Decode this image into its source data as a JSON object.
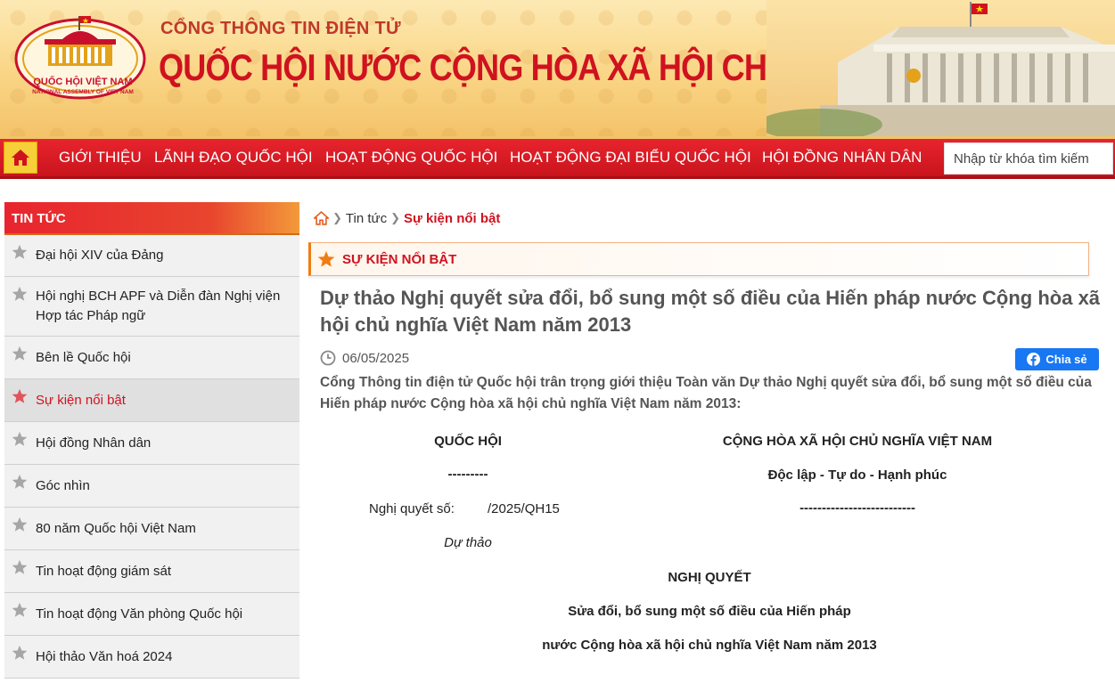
{
  "header": {
    "emblem_line1": "QUỐC HỘI VIỆT NAM",
    "emblem_line2": "NATIONAL ASSEMBLY OF VIET NAM",
    "portal_subtitle": "CỔNG THÔNG TIN ĐIỆN TỬ",
    "portal_title": "QUỐC HỘI NƯỚC CỘNG HÒA XÃ HỘI CHỦ NGHĨA VIỆT NAM"
  },
  "nav": {
    "items": [
      "GIỚI THIỆU",
      "LÃNH ĐẠO QUỐC HỘI",
      "HOẠT ĐỘNG QUỐC HỘI",
      "HOẠT ĐỘNG ĐẠI BIỂU QUỐC HỘI",
      "HỘI ĐỒNG NHÂN DÂN"
    ],
    "search_placeholder": "Nhập từ khóa tìm kiếm"
  },
  "sidebar": {
    "title": "TIN TỨC",
    "items": [
      "Đại hội XIV của Đảng",
      "Hội nghị BCH APF và Diễn đàn Nghị viện Hợp tác Pháp ngữ",
      "Bên lề Quốc hội",
      "Sự kiện nổi bật",
      "Hội đồng Nhân dân",
      "Góc nhìn",
      "80 năm Quốc hội Việt Nam",
      "Tin hoạt động giám sát",
      "Tin hoạt động Văn phòng Quốc hội",
      "Hội thảo Văn hoá 2024"
    ],
    "active_index": 3
  },
  "breadcrumb": {
    "news": "Tin tức",
    "current": "Sự kiện nổi bật"
  },
  "section": {
    "title": "SỰ KIỆN NỔI BẬT"
  },
  "article": {
    "title": "Dự thảo Nghị quyết sửa đổi, bổ sung một số điều của Hiến pháp nước Cộng hòa xã hội chủ nghĩa Việt Nam năm 2013",
    "date": "06/05/2025",
    "share_label": "Chia sẻ",
    "intro": "Cổng Thông tin điện tử Quốc hội trân trọng giới thiệu Toàn văn Dự thảo Nghị quyết sửa đổi, bổ sung một số điều của Hiến pháp nước Cộng hòa xã hội chủ nghĩa Việt Nam năm 2013:",
    "doc": {
      "org": "QUỐC HỘI",
      "org_rule": "---------",
      "resolution_no_label": "Nghị quyết số:",
      "resolution_no": "/2025/QH15",
      "draft": "Dự thảo",
      "country": "CỘNG HÒA XÃ HỘI CHỦ NGHĨA VIỆT NAM",
      "motto": "Độc lập - Tự do - Hạnh phúc",
      "motto_rule": "--------------------------",
      "heading": "NGHỊ QUYẾT",
      "subheading1": "Sửa đổi, bổ sung một số điều của Hiến pháp",
      "subheading2": "nước Cộng hòa xã hội chủ nghĩa Việt Nam năm 2013"
    }
  },
  "colors": {
    "primary_red": "#d0121f",
    "nav_red": "#e8242e",
    "accent_orange": "#f07d12",
    "facebook_blue": "#1877f2"
  }
}
